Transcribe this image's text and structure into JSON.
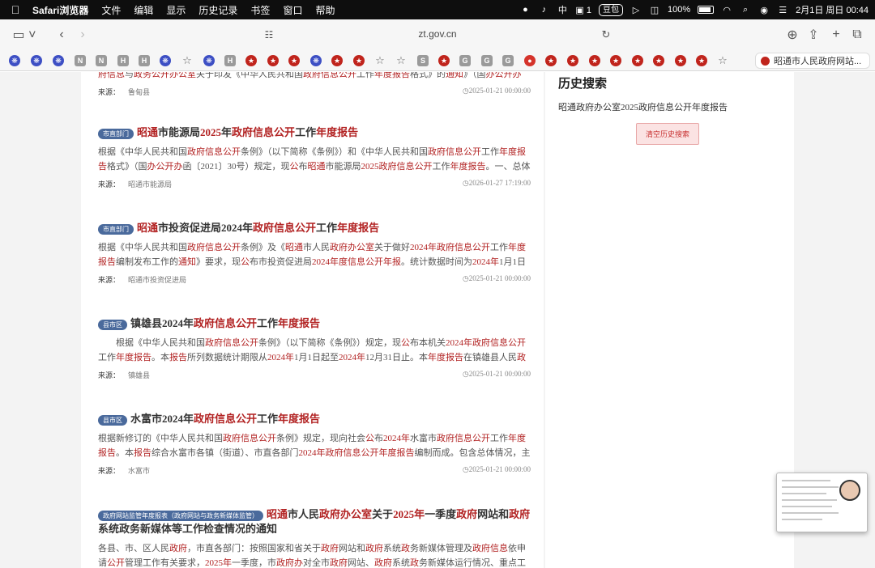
{
  "menubar": {
    "app_name": "Safari浏览器",
    "items": [
      "文件",
      "编辑",
      "显示",
      "历史记录",
      "书签",
      "窗口",
      "帮助"
    ],
    "status": {
      "badge_count": "1",
      "pill_label": "豆包",
      "battery": "100%",
      "datetime": "2月1日 周日  00:44"
    }
  },
  "toolbar": {
    "url": "zt.gov.cn"
  },
  "favorites": {
    "icons": [
      "paw",
      "paw",
      "paw",
      "N",
      "N",
      "H",
      "H",
      "paw",
      "star",
      "paw",
      "H",
      "emblem",
      "emblem",
      "emblem",
      "paw",
      "emblem",
      "emblem",
      "star",
      "star",
      "S",
      "emblem",
      "G",
      "G",
      "G",
      "red",
      "emblem",
      "emblem",
      "emblem",
      "emblem",
      "emblem",
      "emblem",
      "emblem",
      "emblem",
      "star"
    ],
    "active_tab": "昭通市人民政府网站..."
  },
  "results": [
    {
      "id": "r0",
      "tag": "",
      "title": [],
      "summary": [
        [
          "府信息",
          true
        ],
        [
          "与",
          false
        ],
        [
          "政务公开办公室",
          true
        ],
        [
          "关于印发《中华人民共和国",
          false
        ],
        [
          "政府信息公开",
          true
        ],
        [
          "工作",
          false
        ],
        [
          "年度报告",
          true
        ],
        [
          "格式》的",
          false
        ],
        [
          "通知",
          true
        ],
        [
          "》（国",
          false
        ],
        [
          "办公开办",
          true
        ],
        [
          "函…",
          false
        ]
      ],
      "source_label": "来源：",
      "source": "鲁甸县",
      "date": "2025-01-21 00:00:00"
    },
    {
      "id": "r1",
      "tag": "市直部门",
      "title": [
        [
          "昭通",
          true
        ],
        [
          "市能源局",
          false
        ],
        [
          "2025",
          true
        ],
        [
          "年",
          false
        ],
        [
          "政府信息公开",
          true
        ],
        [
          "工作",
          false
        ],
        [
          "年度报告",
          true
        ]
      ],
      "summary": [
        [
          "根据《中华人民共和国",
          false
        ],
        [
          "政府信息公开",
          true
        ],
        [
          "条例》（以下简称《条例》）和《中华人民共和国",
          false
        ],
        [
          "政府信息公开",
          true
        ],
        [
          "工作",
          false
        ],
        [
          "年度报告",
          true
        ],
        [
          "格式》（国",
          false
        ],
        [
          "办公开办",
          true
        ],
        [
          "函〔2021〕30号）规定，现",
          false
        ],
        [
          "公",
          true
        ],
        [
          "布",
          false
        ],
        [
          "昭通",
          true
        ],
        [
          "市能源局",
          false
        ],
        [
          "2025政府信息公开",
          true
        ],
        [
          "工作",
          false
        ],
        [
          "年度报告",
          true
        ],
        [
          "。一、总体情况…",
          false
        ]
      ],
      "source_label": "来源：",
      "source": "昭通市能源局",
      "date": "2026-01-27 17:19:00"
    },
    {
      "id": "r2",
      "tag": "市直部门",
      "title": [
        [
          "昭通",
          true
        ],
        [
          "市投资促进局2024年",
          false
        ],
        [
          "政府信息公开",
          true
        ],
        [
          "工作",
          false
        ],
        [
          "年度报告",
          true
        ]
      ],
      "summary": [
        [
          "根据《中华人民共和国",
          false
        ],
        [
          "政府信息公开",
          true
        ],
        [
          "条例》及《",
          false
        ],
        [
          "昭通",
          true
        ],
        [
          "市人民",
          false
        ],
        [
          "政府办公室",
          true
        ],
        [
          "关于做好",
          false
        ],
        [
          "2024年政府信息公开",
          true
        ],
        [
          "工作",
          false
        ],
        [
          "年度报告",
          true
        ],
        [
          "编制发布工作的",
          false
        ],
        [
          "通知",
          true
        ],
        [
          "》要求，现",
          false
        ],
        [
          "公",
          true
        ],
        [
          "布市投资促进局",
          false
        ],
        [
          "2024年度信息公开年报",
          true
        ],
        [
          "。统计数据时间为",
          false
        ],
        [
          "2024年",
          true
        ],
        [
          "1月1日至",
          false
        ],
        [
          "2024年12…",
          true
        ]
      ],
      "source_label": "来源：",
      "source": "昭通市投资促进局",
      "date": "2025-01-21 00:00:00"
    },
    {
      "id": "r3",
      "tag": "县市区",
      "title": [
        [
          "镇雄县2024年",
          false
        ],
        [
          "政府信息公开",
          true
        ],
        [
          "工作",
          false
        ],
        [
          "年度报告",
          true
        ]
      ],
      "summary": [
        [
          "　　根据《中华人民共和国",
          false
        ],
        [
          "政府信息公开",
          true
        ],
        [
          "条例》（以下简称《条例》）规定，现",
          false
        ],
        [
          "公",
          true
        ],
        [
          "布本机关",
          false
        ],
        [
          "2024年政府信息公开",
          true
        ],
        [
          "工作",
          false
        ],
        [
          "年度报告",
          true
        ],
        [
          "。本",
          false
        ],
        [
          "报告",
          true
        ],
        [
          "所列数据统计期限从",
          false
        ],
        [
          "2024年",
          true
        ],
        [
          "1月1日起至",
          false
        ],
        [
          "2024年",
          true
        ],
        [
          "12月31日止。本",
          false
        ],
        [
          "年度报告",
          true
        ],
        [
          "在镇雄县人民",
          false
        ],
        [
          "政府",
          true
        ],
        [
          "网站…",
          false
        ]
      ],
      "source_label": "来源：",
      "source": "镇雄县",
      "date": "2025-01-21 00:00:00"
    },
    {
      "id": "r4",
      "tag": "县市区",
      "title": [
        [
          "水富市2024年",
          false
        ],
        [
          "政府信息公开",
          true
        ],
        [
          "工作",
          false
        ],
        [
          "年度报告",
          true
        ]
      ],
      "summary": [
        [
          "根据新修订的《中华人民共和国",
          false
        ],
        [
          "政府信息公开",
          true
        ],
        [
          "条例》规定，现向社会",
          false
        ],
        [
          "公",
          true
        ],
        [
          "布",
          false
        ],
        [
          "2024年",
          true
        ],
        [
          "水富市",
          false
        ],
        [
          "政府信息公开",
          true
        ],
        [
          "工作",
          false
        ],
        [
          "年度报告",
          true
        ],
        [
          "。本",
          false
        ],
        [
          "报告",
          true
        ],
        [
          "综合水富市各镇（街道）、市直各部门",
          false
        ],
        [
          "2024年政府信息公开年度报告",
          true
        ],
        [
          "编制而成。包含总体情况，主动",
          false
        ],
        [
          "公开",
          true
        ],
        [
          "政…",
          false
        ]
      ],
      "source_label": "来源：",
      "source": "水富市",
      "date": "2025-01-21 00:00:00"
    },
    {
      "id": "r5",
      "tag": "政府网站监管年度报表（政府网站与政务新媒体监管）",
      "title": [
        [
          "昭通",
          true
        ],
        [
          "市人民",
          false
        ],
        [
          "政府办公室",
          true
        ],
        [
          "关于",
          false
        ],
        [
          "2025年",
          true
        ],
        [
          "一季度",
          false
        ],
        [
          "政府",
          true
        ],
        [
          "网站和",
          false
        ],
        [
          "政府",
          true
        ],
        [
          "系统政务新媒体等工作检查情况的通知",
          false
        ]
      ],
      "summary": [
        [
          "各县、市、区人民",
          false
        ],
        [
          "政府",
          true
        ],
        [
          "，市直各部门：按照国家和省关于",
          false
        ],
        [
          "政府",
          true
        ],
        [
          "网站和",
          false
        ],
        [
          "政府",
          true
        ],
        [
          "系统",
          false
        ],
        [
          "政",
          true
        ],
        [
          "务新媒体管理及",
          false
        ],
        [
          "政府信息",
          true
        ],
        [
          "依申请",
          false
        ],
        [
          "公开",
          true
        ],
        [
          "管理工作有关要求，",
          false
        ],
        [
          "2025年",
          true
        ],
        [
          "一季度，市",
          false
        ],
        [
          "政府办",
          true
        ],
        [
          "对全市",
          false
        ],
        [
          "政府",
          true
        ],
        [
          "网站、",
          false
        ],
        [
          "政府",
          true
        ],
        [
          "系统",
          false
        ],
        [
          "政",
          true
        ],
        [
          "务新媒体运行情况、重点工作落实情况…",
          false
        ]
      ],
      "source_label": "",
      "source": "",
      "date": ""
    }
  ],
  "sidebar": {
    "title": "历史搜索",
    "history_items": [
      "昭通政府办公室2025政府信息公开年度报告"
    ],
    "clear_button": "清空历史搜索"
  },
  "colors": {
    "highlight": "#b22222",
    "tag_bg": "#4a6a9c",
    "clear_bg": "#fbe3e3"
  }
}
